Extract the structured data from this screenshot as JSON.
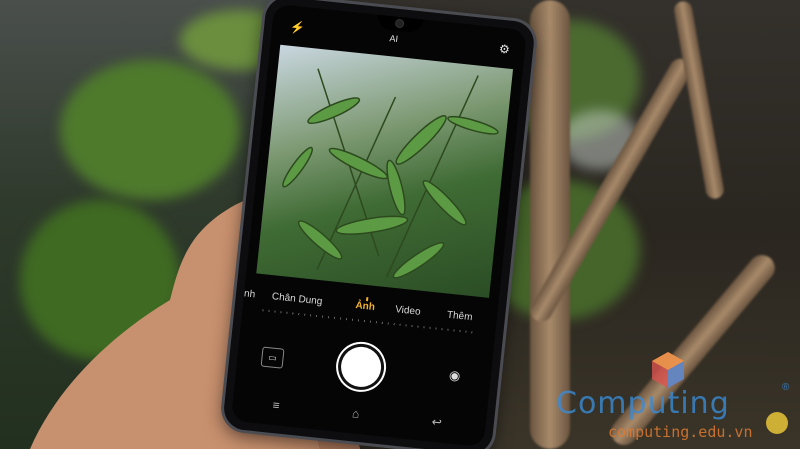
{
  "camera": {
    "top_icons": [
      "flash-icon",
      "ai-icon",
      "settings-gear-icon"
    ],
    "ai_label": "AI",
    "modes": [
      "nh",
      "Chân Dung",
      "Ảnh",
      "Video",
      "Thêm"
    ],
    "active_mode": "Ảnh",
    "bottom_icons": [
      "gallery-icon",
      "shutter-button",
      "switch-camera-icon"
    ],
    "nav_icons": [
      "menu-icon",
      "home-icon",
      "back-icon"
    ]
  },
  "watermark": {
    "brand": "Computing",
    "registered": "®",
    "url": "computing.edu.vn"
  },
  "colors": {
    "active_mode": "#f2b231",
    "brand_blue": "#3a8bd6",
    "url_orange": "#e07b30"
  }
}
